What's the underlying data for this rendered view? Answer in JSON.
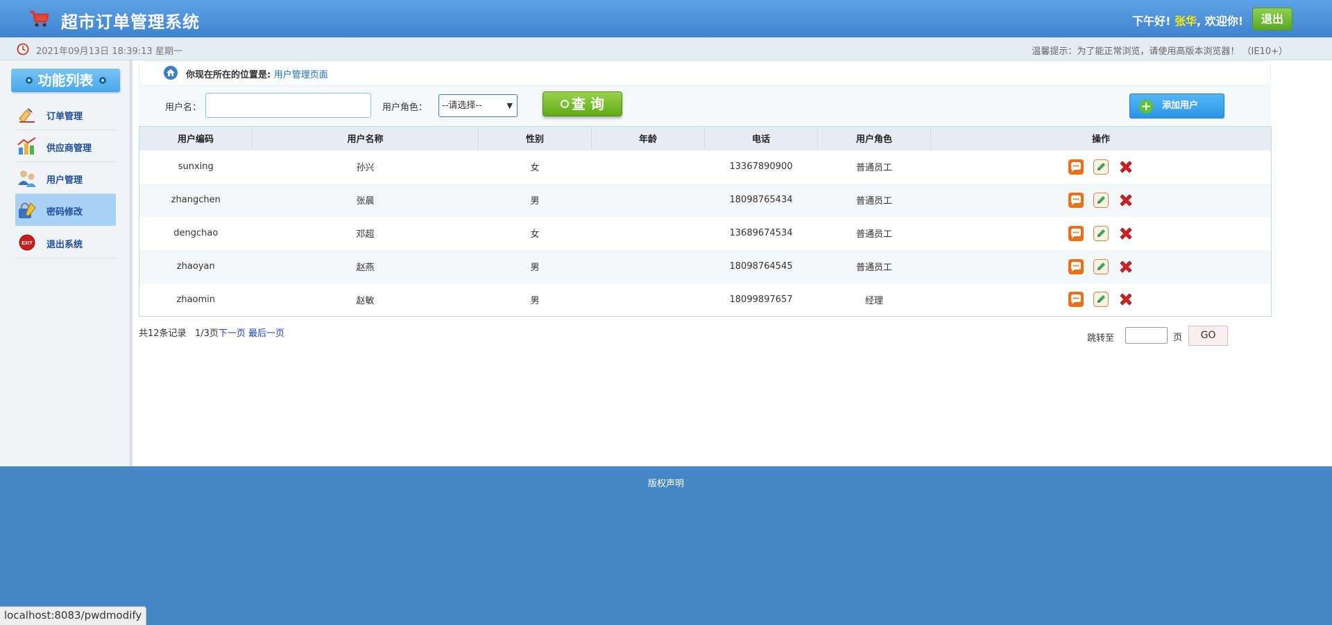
{
  "header": {
    "title": "超市订单管理系统",
    "greeting_prefix": "下午好!",
    "user_name": "张华",
    "greeting_suffix": ", 欢迎你!",
    "logout_label": "退出"
  },
  "infobar": {
    "datetime": "2021年09月13日 18:39:13 星期一",
    "tip": "温馨提示：为了能正常浏览，请使用高版本浏览器！ （IE10+）"
  },
  "sidebar": {
    "title": "功能列表",
    "items": [
      {
        "label": "订单管理",
        "icon": "order-icon"
      },
      {
        "label": "供应商管理",
        "icon": "provider-icon"
      },
      {
        "label": "用户管理",
        "icon": "users-icon"
      },
      {
        "label": "密码修改",
        "icon": "password-icon",
        "active": true
      },
      {
        "label": "退出系统",
        "icon": "exit-icon"
      }
    ]
  },
  "breadcrumb": {
    "prefix": "你现在所在的位置是:",
    "current": "用户管理页面"
  },
  "search": {
    "username_label": "用户名：",
    "username_value": "",
    "role_label": "用户角色：",
    "role_selected": "--请选择--",
    "query_label": "查 询",
    "add_label": "添加用户"
  },
  "table": {
    "headers": [
      "用户编码",
      "用户名称",
      "性别",
      "年龄",
      "电话",
      "用户角色",
      "操作"
    ],
    "rows": [
      {
        "code": "sunxing",
        "name": "孙兴",
        "gender": "女",
        "age": "",
        "phone": "13367890900",
        "role": "普通员工"
      },
      {
        "code": "zhangchen",
        "name": "张晨",
        "gender": "男",
        "age": "",
        "phone": "18098765434",
        "role": "普通员工"
      },
      {
        "code": "dengchao",
        "name": "邓超",
        "gender": "女",
        "age": "",
        "phone": "13689674534",
        "role": "普通员工"
      },
      {
        "code": "zhaoyan",
        "name": "赵燕",
        "gender": "男",
        "age": "",
        "phone": "18098764545",
        "role": "普通员工"
      },
      {
        "code": "zhaomin",
        "name": "赵敏",
        "gender": "男",
        "age": "",
        "phone": "18099897657",
        "role": "经理"
      }
    ]
  },
  "pagination": {
    "total": "共12条记录",
    "page": "1/3页",
    "next": "下一页",
    "last": "最后一页",
    "jump_label": "跳转至",
    "page_unit": "页",
    "go_label": "GO"
  },
  "footer": {
    "copyright": "版权声明"
  },
  "statusbar": {
    "url": "localhost:8083/pwdmodify"
  },
  "colors": {
    "header": "#3d82cf",
    "footer": "#4387c5",
    "accent_green": "#60ab19",
    "accent_blue": "#2a95e6",
    "username_highlight": "#ffea00"
  }
}
